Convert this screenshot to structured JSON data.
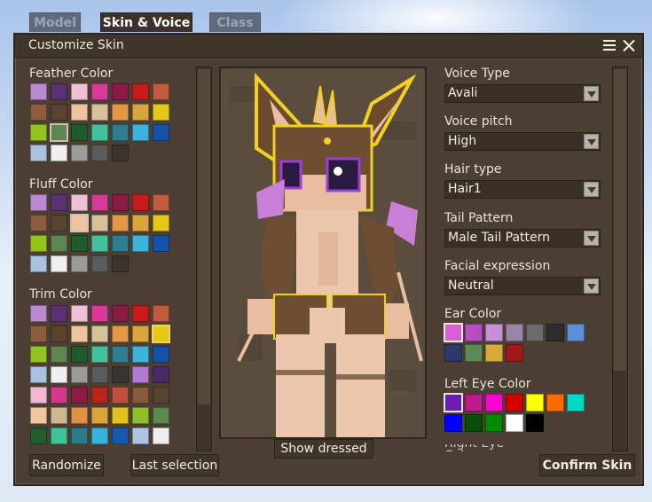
{
  "tabs": [
    {
      "label": "Model",
      "active": false
    },
    {
      "label": "Skin & Voice",
      "active": true
    },
    {
      "label": "Class",
      "active": false
    }
  ],
  "window": {
    "title": "Customize Skin"
  },
  "left": {
    "sections": [
      {
        "label": "Feather Color",
        "selected_index": 15,
        "colors": [
          "#b98ad1",
          "#5d2f73",
          "#f0bfd6",
          "#d6399a",
          "#8a1b45",
          "#c71a1a",
          "#c25a3c",
          "#8e5b3e",
          "#5b4331",
          "#efc39c",
          "#d8c09a",
          "#e39849",
          "#d9a53c",
          "#e4c717",
          "#93c41d",
          "#5d874f",
          "#1e5a2c",
          "#42c29c",
          "#2b7f8e",
          "#3ab4dc",
          "#1253a8",
          "#abc2df",
          "#efefef",
          "#9b9b9b",
          "#5c5c5c",
          "#3a3530"
        ]
      },
      {
        "label": "Fluff Color",
        "selected_index": 9,
        "colors": [
          "#b98ad1",
          "#5d2f73",
          "#f0bfd6",
          "#d6399a",
          "#8a1b45",
          "#c71a1a",
          "#c25a3c",
          "#8e5b3e",
          "#5b4331",
          "#efc39c",
          "#d8c09a",
          "#e39849",
          "#d9a53c",
          "#e4c717",
          "#93c41d",
          "#5d874f",
          "#1e5a2c",
          "#42c29c",
          "#2b7f8e",
          "#3ab4dc",
          "#1253a8",
          "#abc2df",
          "#efefef",
          "#9b9b9b",
          "#5c5c5c",
          "#3a3530"
        ]
      },
      {
        "label": "Trim Color",
        "selected_index": 13,
        "colors": [
          "#b98ad1",
          "#5d2f73",
          "#f0bfd6",
          "#d6399a",
          "#8a1b45",
          "#c71a1a",
          "#c25a3c",
          "#8e5b3e",
          "#5b4331",
          "#efc39c",
          "#d8c09a",
          "#e39849",
          "#d9a53c",
          "#e4c717",
          "#93c41d",
          "#5d874f",
          "#1e5a2c",
          "#42c29c",
          "#2b7f8e",
          "#3ab4dc",
          "#1253a8",
          "#abc2df",
          "#efefef",
          "#9b9b9b",
          "#5c5c5c",
          "#3a3530",
          "#b07ad6",
          "#4a2a63",
          "#f0b8d4",
          "#d33a8c",
          "#8e1c42",
          "#b8241c",
          "#c0503b",
          "#8a5a3c",
          "#5a4230",
          "#f2c79f",
          "#cdb892",
          "#e18f46",
          "#dba43a",
          "#e2c21b",
          "#8fbf2a",
          "#5c8a4e",
          "#1f5d2e",
          "#3fc49a",
          "#2b7d8c",
          "#36b2de",
          "#1658ad",
          "#aec4e0",
          "#eeeeee"
        ]
      }
    ],
    "randomize_label": "Randomize",
    "last_selection_label": "Last selection"
  },
  "preview": {
    "show_dressed_label": "Show dressed"
  },
  "right": {
    "dropdowns": [
      {
        "label": "Voice Type",
        "value": "Avali"
      },
      {
        "label": "Voice pitch",
        "value": "High"
      },
      {
        "label": "Hair type",
        "value": "Hair1"
      },
      {
        "label": "Tail Pattern",
        "value": "Male Tail Pattern"
      },
      {
        "label": "Facial expression",
        "value": "Neutral"
      }
    ],
    "ear_color": {
      "label": "Ear Color",
      "selected_index": 0,
      "colors": [
        "#d65fd6",
        "#b94dc4",
        "#c78fd6",
        "#9a84a8",
        "#6b6b6b",
        "#2c2c2c",
        "#5b8fd6",
        "#2b3a6b",
        "#5e8a55",
        "#d6a93a",
        "#a01818"
      ]
    },
    "left_eye_color": {
      "label": "Left Eye Color",
      "selected_index": 0,
      "colors": [
        "#6a1fb0",
        "#c2188f",
        "#ff00d2",
        "#d40000",
        "#ffff00",
        "#ff6a00",
        "#00d9c5",
        "#0000ff",
        "#0a4d0a",
        "#008a00",
        "#ffffff",
        "#000000"
      ]
    },
    "next_label_partial": "Right Eye Color",
    "confirm_label": "Confirm Skin"
  }
}
